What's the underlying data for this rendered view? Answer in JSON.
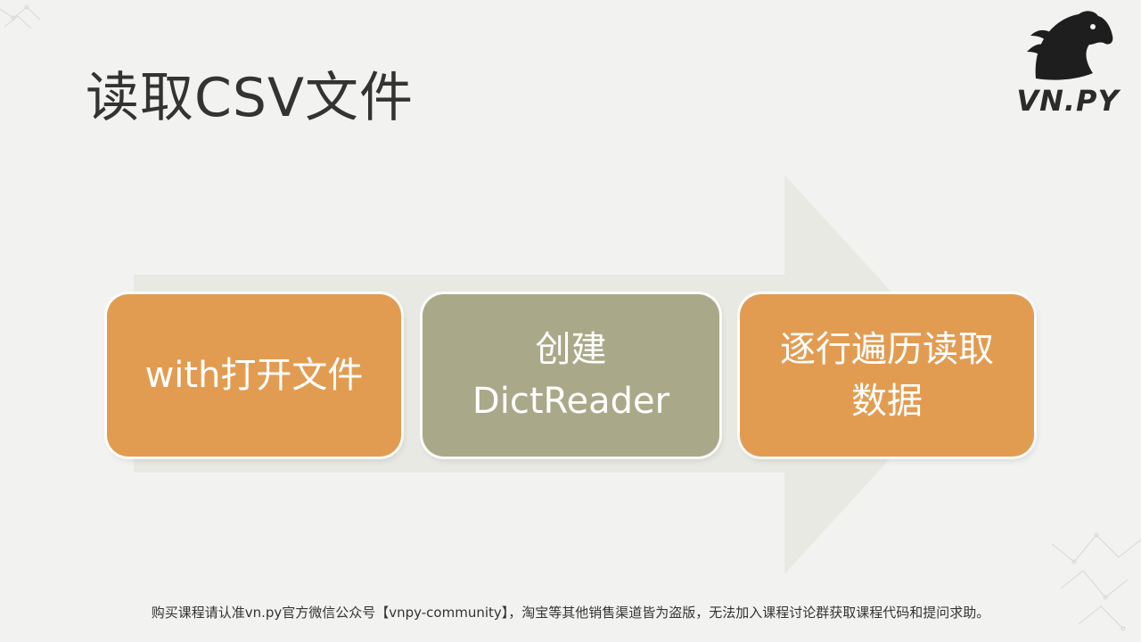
{
  "title": "读取CSV文件",
  "logo": {
    "text": "VN.PY",
    "icon": "horse-head-icon"
  },
  "steps": [
    {
      "lines": [
        "with打开文件"
      ],
      "color": "#e29c52"
    },
    {
      "lines": [
        "创建",
        "DictReader"
      ],
      "color": "#a9a98a"
    },
    {
      "lines": [
        "逐行遍历读取",
        "数据"
      ],
      "color": "#e29c52"
    }
  ],
  "footer": "购买课程请认准vn.py官方微信公众号【vnpy-community】，淘宝等其他销售渠道皆为盗版，无法加入课程讨论群获取课程代码和提问求助。",
  "colors": {
    "arrow": "#e9e9e4",
    "title": "#333333",
    "background": "#f2f2f0"
  }
}
